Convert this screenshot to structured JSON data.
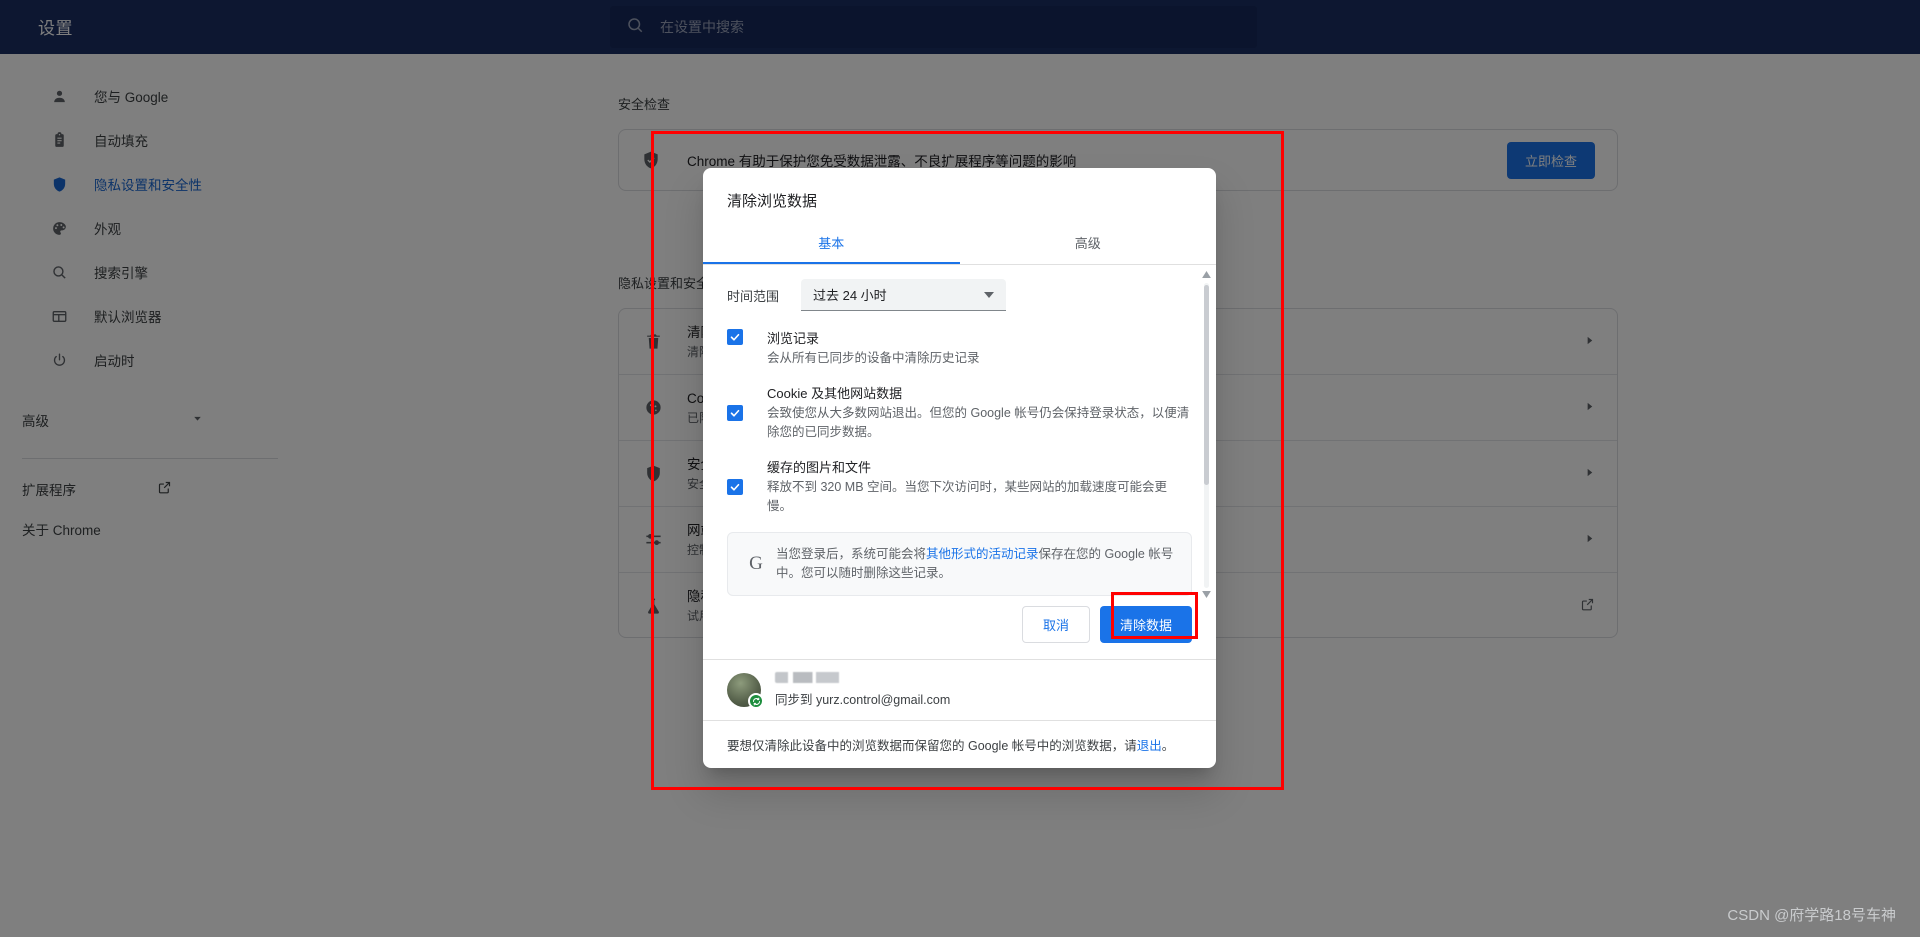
{
  "topbar": {
    "title": "设置",
    "search_placeholder": "在设置中搜索",
    "search_value": "",
    "search_icon": "search-icon"
  },
  "sidebar": {
    "items": [
      {
        "label": "您与 Google",
        "icon": "person-icon",
        "active": false
      },
      {
        "label": "自动填充",
        "icon": "clipboard-icon",
        "active": false
      },
      {
        "label": "隐私设置和安全性",
        "icon": "shield-icon",
        "active": true
      },
      {
        "label": "外观",
        "icon": "palette-icon",
        "active": false
      },
      {
        "label": "搜索引擎",
        "icon": "search-icon",
        "active": false
      },
      {
        "label": "默认浏览器",
        "icon": "browser-window-icon",
        "active": false
      },
      {
        "label": "启动时",
        "icon": "power-icon",
        "active": false
      }
    ],
    "advanced_label": "高级",
    "advanced_icon": "chevron-down-icon",
    "extensions_label": "扩展程序",
    "extensions_icon": "external-link-icon",
    "about_label": "关于 Chrome"
  },
  "main": {
    "safety_section_title": "安全检查",
    "safety_card": {
      "icon": "shield-check-icon",
      "text": "Chrome 有助于保护您免受数据泄露、不良扩展程序等问题的影响",
      "button_label": "立即检查"
    },
    "privacy_section_title": "隐私设置和安全性",
    "privacy_rows": [
      {
        "icon": "trash-icon",
        "title": "清除浏览数据",
        "subtitle": "清除浏览记录、Cookie、缓存及其他数据",
        "arrow": "chevron-right-icon"
      },
      {
        "icon": "cookie-icon",
        "title": "Cookie 及其他网站数据",
        "subtitle": "已阻止第三方 Cookie",
        "arrow": "chevron-right-icon"
      },
      {
        "icon": "shield-icon",
        "title": "安全",
        "subtitle": "安全浏览（防范危险网站）及其他安全设置",
        "arrow": "chevron-right-icon"
      },
      {
        "icon": "sliders-icon",
        "title": "网站设置",
        "subtitle": "控制网站可使用和显示的信息（如位置信息、摄像头、弹出式窗口等）",
        "arrow": "chevron-right-icon"
      },
      {
        "icon": "flask-icon",
        "title": "隐私沙盒",
        "subtitle": "试用版功能已开启",
        "arrow": "external-link-icon"
      }
    ]
  },
  "dialog": {
    "title": "清除浏览数据",
    "tabs": [
      {
        "label": "基本",
        "selected": true
      },
      {
        "label": "高级",
        "selected": false
      }
    ],
    "time_range": {
      "label": "时间范围",
      "value": "过去 24 小时",
      "caret_icon": "caret-down-icon"
    },
    "options": [
      {
        "checked": true,
        "title": "浏览记录",
        "desc": "会从所有已同步的设备中清除历史记录"
      },
      {
        "checked": true,
        "title": "Cookie 及其他网站数据",
        "desc": "会致使您从大多数网站退出。但您的 Google 帐号仍会保持登录状态，以便清除您的已同步数据。"
      },
      {
        "checked": true,
        "title": "缓存的图片和文件",
        "desc": "释放不到 320 MB 空间。当您下次访问时，某些网站的加载速度可能会更慢。"
      }
    ],
    "google_note": {
      "logo": "G",
      "text_before": "当您登录后，系统可能会将",
      "link_text": "其他形式的活动记录",
      "text_after": "保存在您的 Google 帐号中。您可以随时删除这些记录。"
    },
    "cancel_label": "取消",
    "confirm_label": "清除数据",
    "account": {
      "name_redacted": true,
      "sync_text": "同步到 yurz.control@gmail.com",
      "sync_badge_icon": "sync-icon",
      "avatar_icon": "avatar"
    },
    "footer": {
      "text_before": "要想仅清除此设备中的浏览数据而保留您的 Google 帐号中的浏览数据，请",
      "link_text": "退出",
      "text_after": "。"
    },
    "scrollbar": {
      "up_icon": "triangle-up-icon",
      "down_icon": "triangle-down-icon"
    }
  },
  "annotations": {
    "highlight_color": "#ff0000",
    "main_highlight": "dialog-and-privacy-region",
    "button_highlight": "clear-data-button"
  },
  "watermark": "CSDN @府学路18号车神"
}
